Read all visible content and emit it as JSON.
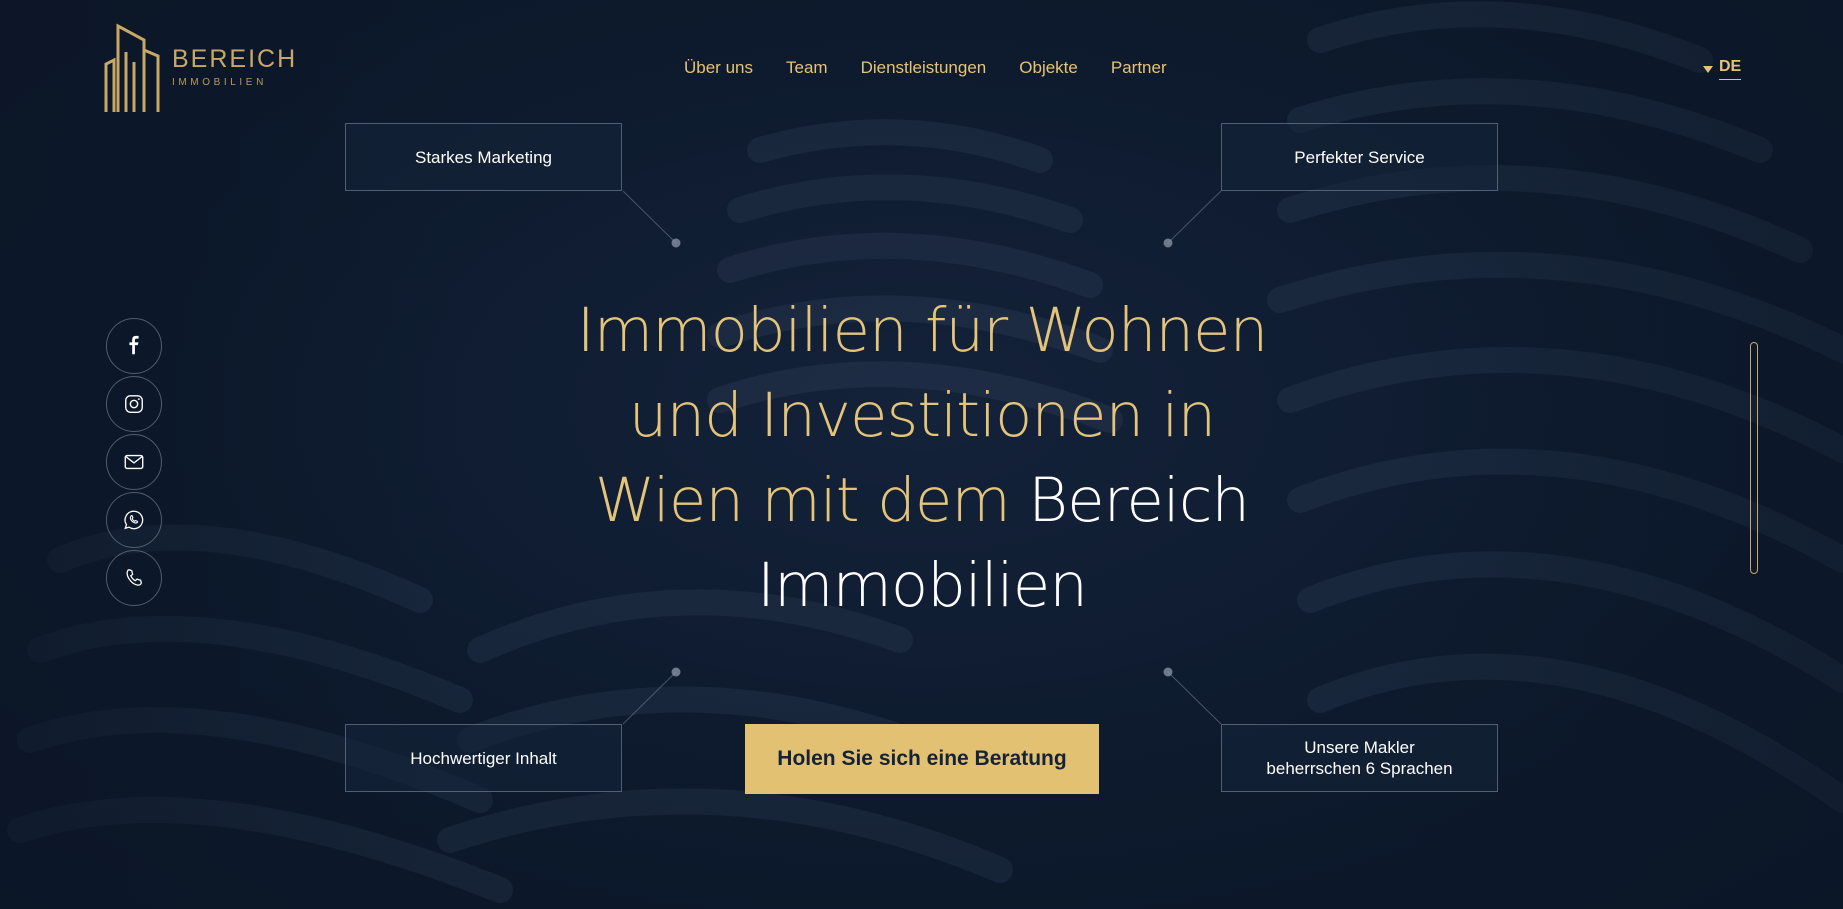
{
  "brand": {
    "name": "BEREICH",
    "sub": "IMMOBILIEN"
  },
  "nav": {
    "items": [
      {
        "label": "Über uns"
      },
      {
        "label": "Team"
      },
      {
        "label": "Dienstleistungen"
      },
      {
        "label": "Objekte"
      },
      {
        "label": "Partner"
      }
    ]
  },
  "language": {
    "current": "DE"
  },
  "social": [
    "facebook-icon",
    "instagram-icon",
    "mail-icon",
    "whatsapp-icon",
    "phone-icon"
  ],
  "features": {
    "top_left": "Starkes Marketing",
    "top_right": "Perfekter Service",
    "bottom_left": "Hochwertiger Inhalt",
    "bottom_right_line1": "Unsere Makler",
    "bottom_right_line2": "beherrschen 6 Sprachen"
  },
  "hero": {
    "line1": "Immobilien für Wohnen",
    "line2": "und Investitionen in",
    "line3_gold": "Wien mit dem",
    "line3_white": "Bereich",
    "line4": "Immobilien"
  },
  "cta": {
    "label": "Holen Sie sich eine Beratung"
  },
  "colors": {
    "background": "#0f1b2e",
    "accent": "#e2c272",
    "nav_text": "#e6c376"
  }
}
